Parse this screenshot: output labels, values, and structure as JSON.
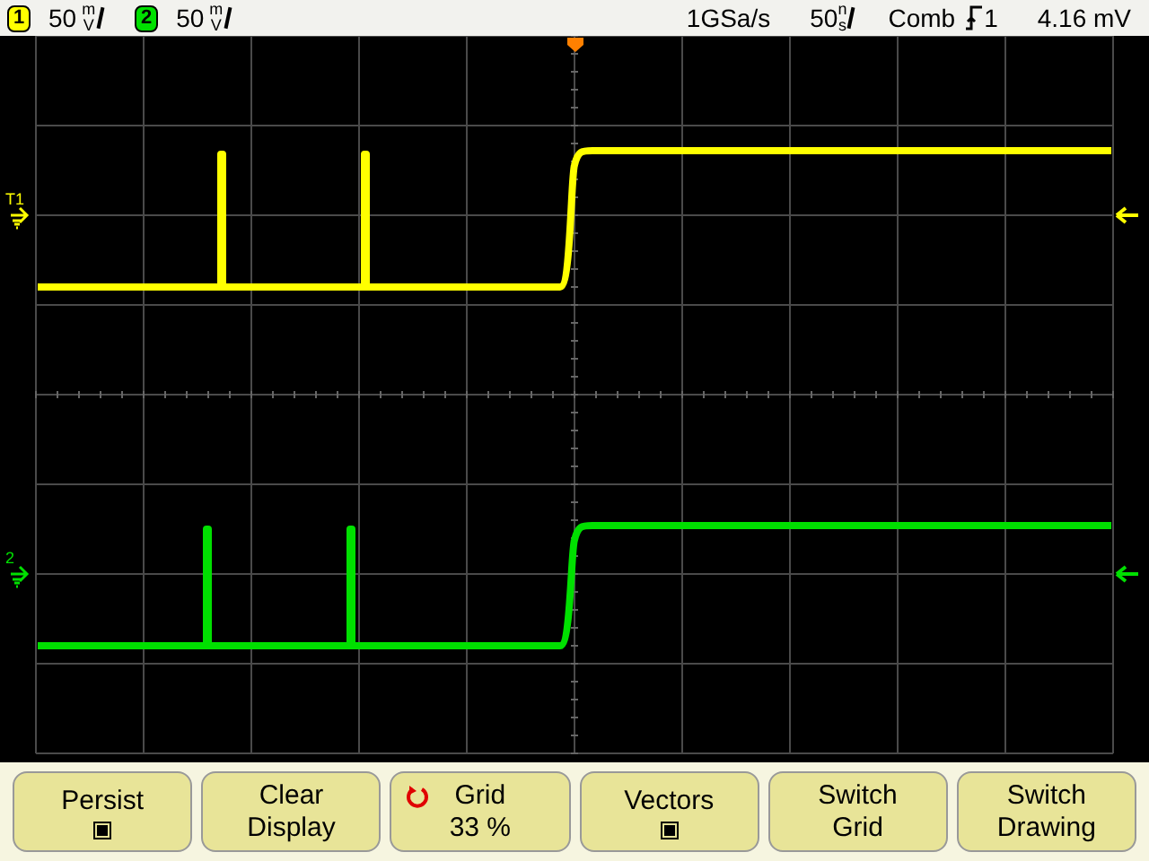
{
  "status_bar": {
    "channels": [
      {
        "number": "1",
        "scale": "50",
        "unit_top": "m",
        "unit_bottom": "V",
        "color": "#ffff00"
      },
      {
        "number": "2",
        "scale": "50",
        "unit_top": "m",
        "unit_bottom": "V",
        "color": "#00e000"
      }
    ],
    "sample_rate": "1GSa/s",
    "timebase": {
      "scale": "50",
      "unit_top": "n",
      "unit_bottom": "s"
    },
    "trigger": {
      "mode": "Comb",
      "source": "1"
    },
    "reading": "4.16 mV"
  },
  "traces": [
    {
      "marker_label": "T1",
      "color": "#ffff00"
    },
    {
      "marker_label": "2",
      "color": "#00e000"
    }
  ],
  "softkeys": [
    {
      "lines": [
        "Persist"
      ],
      "kind": "indicator",
      "checked": true
    },
    {
      "lines": [
        "Clear",
        "Display"
      ],
      "kind": "plain"
    },
    {
      "lines": [
        "Grid",
        "33 %"
      ],
      "kind": "knob"
    },
    {
      "lines": [
        "Vectors"
      ],
      "kind": "indicator",
      "checked": true
    },
    {
      "lines": [
        "Switch",
        "Grid"
      ],
      "kind": "plain"
    },
    {
      "lines": [
        "Switch",
        "Drawing"
      ],
      "kind": "plain"
    }
  ]
}
